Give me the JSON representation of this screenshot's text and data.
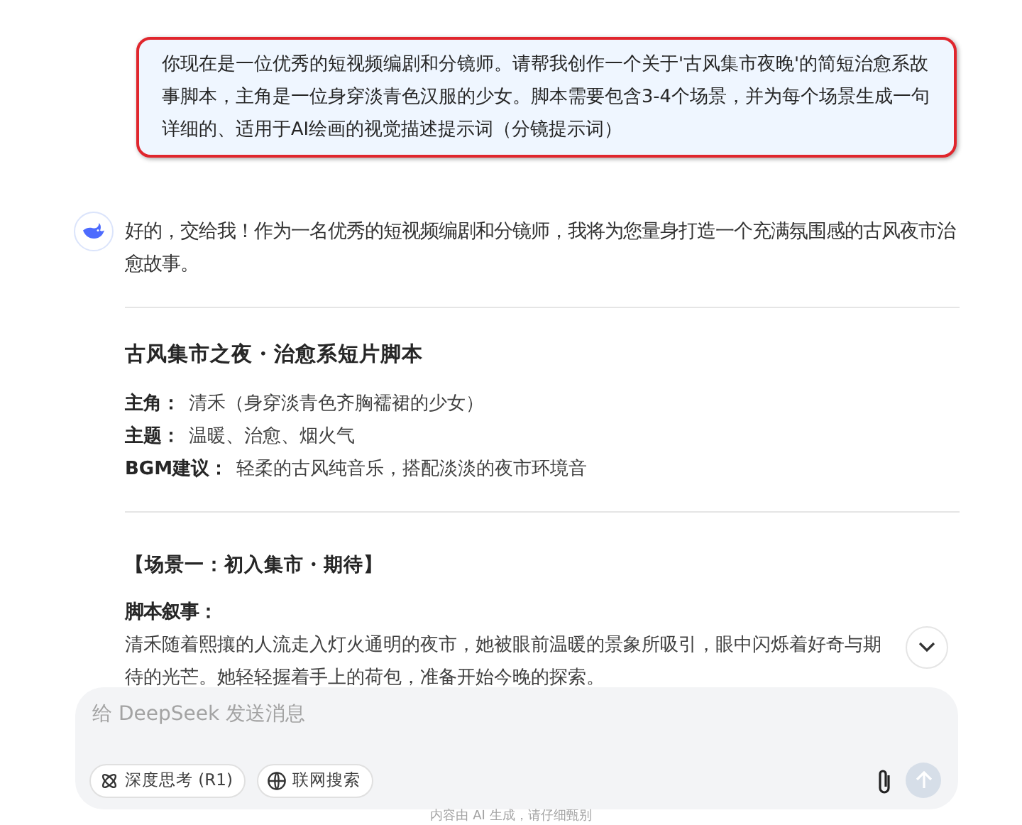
{
  "user_message": {
    "text": "你现在是一位优秀的短视频编剧和分镜师。请帮我创作一个关于'古风集市夜晚'的简短治愈系故事脚本，主角是一位身穿淡青色汉服的少女。脚本需要包含3-4个场景，并为每个场景生成一句详细的、适用于AI绘画的视觉描述提示词（分镜提示词）",
    "highlighted": true
  },
  "assistant": {
    "intro": "好的，交给我！作为一名优秀的短视频编剧和分镜师，我将为您量身打造一个充满氛围感的古风夜市治愈故事。",
    "title": "古风集市之夜・治愈系短片脚本",
    "fields": [
      {
        "label": "主角：",
        "value": "清禾（身穿淡青色齐胸襦裙的少女）"
      },
      {
        "label": "主题：",
        "value": "温暖、治愈、烟火气"
      },
      {
        "label": "BGM建议：",
        "value": "轻柔的古风纯音乐，搭配淡淡的夜市环境音"
      }
    ],
    "scene_heading": "【场景一：初入集市・期待】",
    "narrative_label": "脚本叙事：",
    "narrative": "清禾随着熙攘的人流走入灯火通明的夜市，她被眼前温暖的景象所吸引，眼中闪烁着好奇与期待的光芒。她轻轻握着手上的荷包，准备开始今晚的探索。"
  },
  "composer": {
    "placeholder": "给 DeepSeek 发送消息",
    "toggles": [
      {
        "kind": "deepthink",
        "label": "深度思考 (R1)",
        "selected": false
      },
      {
        "kind": "search",
        "label": "联网搜索",
        "selected": false
      }
    ],
    "send_disabled": true
  },
  "footer": "内容由 AI 生成，请仔细甄别"
}
